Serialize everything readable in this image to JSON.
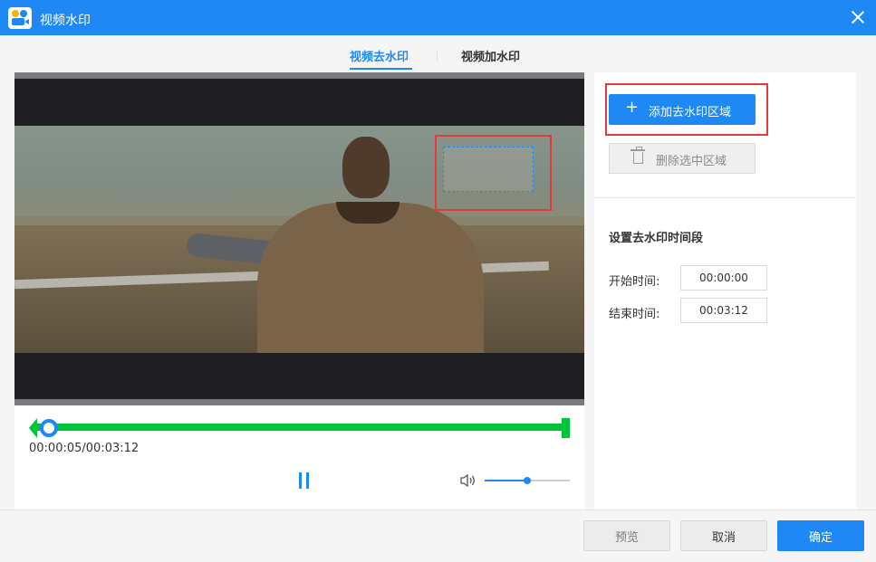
{
  "window": {
    "title": "视频水印"
  },
  "tabs": [
    {
      "label": "视频去水印",
      "active": true
    },
    {
      "label": "视频加水印",
      "active": false
    }
  ],
  "player": {
    "current_time": "00:00:05",
    "total_time": "00:03:12",
    "time_display": "00:00:05/00:03:12",
    "progress_fraction": 0.03,
    "volume_fraction": 0.5
  },
  "right_panel": {
    "add_region_label": "添加去水印区域",
    "delete_region_label": "删除选中区域",
    "section_title": "设置去水印时间段",
    "start_label": "开始时间:",
    "start_value": "00:00:00",
    "end_label": "结束时间:",
    "end_value": "00:03:12"
  },
  "footer": {
    "preview_label": "预览",
    "cancel_label": "取消",
    "ok_label": "确定"
  },
  "colors": {
    "accent": "#1e88f5",
    "timeline": "#00c53a",
    "highlight": "#e53a3a"
  }
}
